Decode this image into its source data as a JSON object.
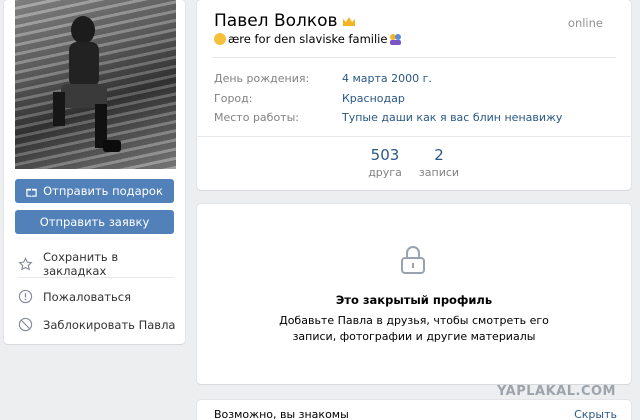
{
  "profile": {
    "name": "Павел Волков",
    "online": "online",
    "status": "ære for den slaviske familie",
    "info": [
      {
        "label": "День рождения:",
        "value": "4 марта 2000 г."
      },
      {
        "label": "Город:",
        "value": "Краснодар"
      },
      {
        "label": "Место работы:",
        "value": "Тупые даши как я вас блин ненавижу"
      }
    ],
    "counters": [
      {
        "num": "503",
        "label": "друга"
      },
      {
        "num": "2",
        "label": "записи"
      }
    ]
  },
  "sidebar": {
    "gift_label": "Отправить подарок",
    "request_label": "Отправить заявку",
    "bookmark_label": "Сохранить в закладках",
    "report_label": "Пожаловаться",
    "block_label": "Заблокировать Павла"
  },
  "closed": {
    "title": "Это закрытый профиль",
    "text": "Добавьте Павла в друзья, чтобы смотреть его записи, фотографии и другие материалы"
  },
  "suggest": {
    "title": "Возможно, вы знакомы",
    "hide": "Скрыть"
  },
  "watermark": "YAPLAKAL.COM",
  "colors": {
    "accent": "#5181b8",
    "link": "#2a5885",
    "bg": "#edeef0"
  }
}
